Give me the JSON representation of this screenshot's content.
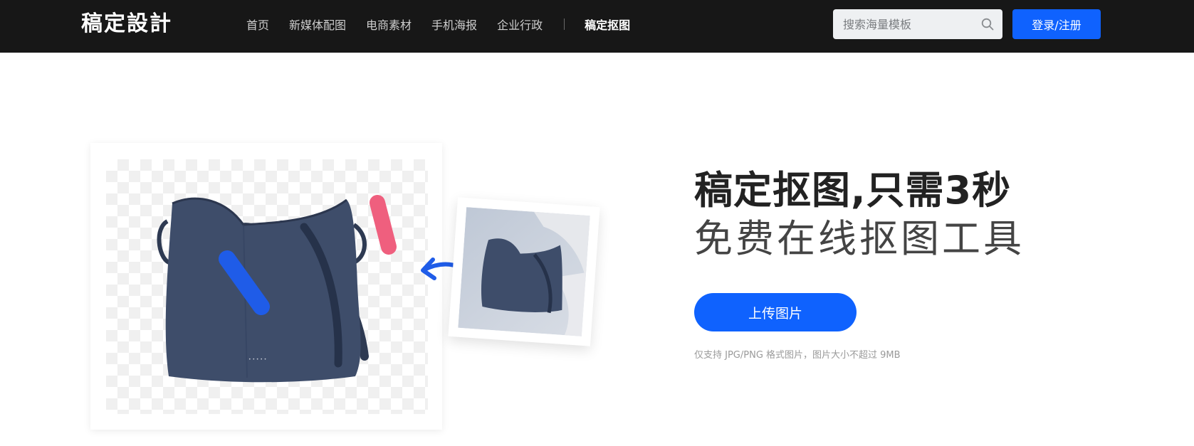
{
  "header": {
    "logo": "稿定設計",
    "nav": [
      {
        "label": "首页"
      },
      {
        "label": "新媒体配图"
      },
      {
        "label": "电商素材"
      },
      {
        "label": "手机海报"
      },
      {
        "label": "企业行政"
      }
    ],
    "active_nav": "稿定抠图",
    "search": {
      "placeholder": "搜索海量模板",
      "value": ""
    },
    "login_label": "登录/注册"
  },
  "hero": {
    "title": "稿定抠图,只需3秒",
    "subtitle": "免费在线抠图工具",
    "upload_label": "上传图片",
    "hint": "仅支持 JPG/PNG 格式图片，图片大小不超过 9MB"
  },
  "colors": {
    "topbar": "#171717",
    "accent": "#0f62fe",
    "stroke_blue": "#1f5ce8",
    "stroke_pink": "#ef5f7e",
    "bag": "#3e4d6a"
  },
  "icons": {
    "search": "search-icon",
    "arrow": "curved-arrow-icon"
  }
}
